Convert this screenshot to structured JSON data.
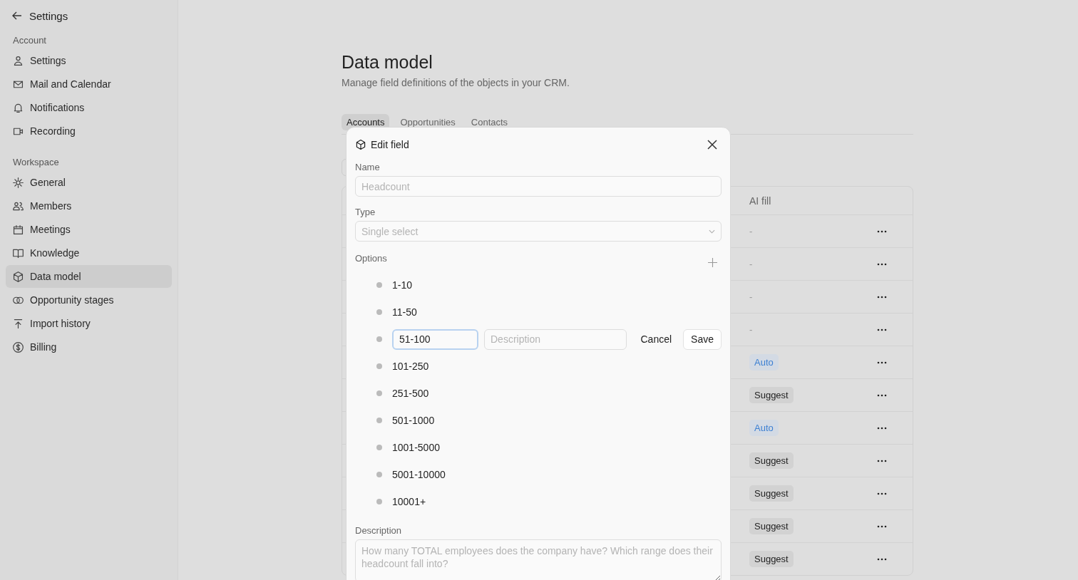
{
  "sidebar": {
    "back_label": "Settings",
    "sections": [
      {
        "label": "Account",
        "items": [
          {
            "label": "Settings",
            "selected": false
          },
          {
            "label": "Mail and Calendar",
            "selected": false
          },
          {
            "label": "Notifications",
            "selected": false
          },
          {
            "label": "Recording",
            "selected": false
          }
        ]
      },
      {
        "label": "Workspace",
        "items": [
          {
            "label": "General",
            "selected": false
          },
          {
            "label": "Members",
            "selected": false
          },
          {
            "label": "Meetings",
            "selected": false
          },
          {
            "label": "Knowledge",
            "selected": false
          },
          {
            "label": "Data model",
            "selected": true
          },
          {
            "label": "Opportunity stages",
            "selected": false
          },
          {
            "label": "Import history",
            "selected": false
          },
          {
            "label": "Billing",
            "selected": false
          }
        ]
      }
    ]
  },
  "page": {
    "title": "Data model",
    "subtitle": "Manage field definitions of the objects in your CRM."
  },
  "tabs": [
    {
      "label": "Accounts",
      "selected": true
    },
    {
      "label": "Opportunities",
      "selected": false
    },
    {
      "label": "Contacts",
      "selected": false
    }
  ],
  "table": {
    "columns": [
      "AI fill"
    ],
    "rows": [
      {
        "kind": "none",
        "ai_fill": "-"
      },
      {
        "kind": "none",
        "ai_fill": "-"
      },
      {
        "kind": "none",
        "ai_fill": "-"
      },
      {
        "kind": "none",
        "ai_fill": "-"
      },
      {
        "kind": "auto",
        "ai_fill": "Auto"
      },
      {
        "kind": "suggest",
        "ai_fill": "Suggest"
      },
      {
        "kind": "auto",
        "ai_fill": "Auto"
      },
      {
        "kind": "suggest",
        "ai_fill": "Suggest"
      },
      {
        "kind": "suggest",
        "ai_fill": "Suggest"
      },
      {
        "kind": "suggest",
        "ai_fill": "Suggest"
      },
      {
        "kind": "suggest",
        "ai_fill": "Suggest"
      }
    ]
  },
  "dialog": {
    "title": "Edit field",
    "name": {
      "label": "Name",
      "placeholder": "Headcount"
    },
    "type": {
      "label": "Type",
      "placeholder": "Single select"
    },
    "options_label": "Options",
    "options": [
      {
        "label": "1-10",
        "editing": false
      },
      {
        "label": "11-50",
        "editing": false
      },
      {
        "label": "51-100",
        "editing": true
      },
      {
        "label": "101-250",
        "editing": false
      },
      {
        "label": "251-500",
        "editing": false
      },
      {
        "label": "501-1000",
        "editing": false
      },
      {
        "label": "1001-5000",
        "editing": false
      },
      {
        "label": "5001-10000",
        "editing": false
      },
      {
        "label": "10001+",
        "editing": false
      }
    ],
    "editor": {
      "description_placeholder": "Description",
      "cancel": "Cancel",
      "save": "Save"
    },
    "description": {
      "label": "Description",
      "placeholder": "How many TOTAL employees does the company have? Which range does their headcount fall into?"
    }
  }
}
